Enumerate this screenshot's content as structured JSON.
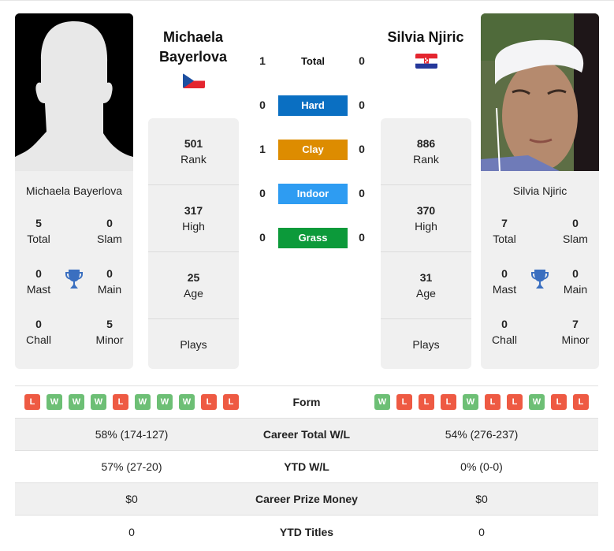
{
  "players": {
    "left": {
      "name": "Michaela Bayerlova",
      "name_line1": "Michaela",
      "name_line2": "Bayerlova",
      "country_flag": "czech-republic-flag",
      "photo": "silhouette-placeholder",
      "titles": {
        "total": {
          "value": "5",
          "label": "Total"
        },
        "slam": {
          "value": "0",
          "label": "Slam"
        },
        "mast": {
          "value": "0",
          "label": "Mast"
        },
        "main": {
          "value": "0",
          "label": "Main"
        },
        "chall": {
          "value": "0",
          "label": "Chall"
        },
        "minor": {
          "value": "5",
          "label": "Minor"
        }
      },
      "stats": {
        "rank": {
          "value": "501",
          "label": "Rank"
        },
        "high": {
          "value": "317",
          "label": "High"
        },
        "age": {
          "value": "25",
          "label": "Age"
        },
        "plays": {
          "value": "",
          "label": "Plays"
        }
      },
      "form": [
        "L",
        "W",
        "W",
        "W",
        "L",
        "W",
        "W",
        "W",
        "L",
        "L"
      ]
    },
    "right": {
      "name": "Silvia Njiric",
      "country_flag": "croatia-flag",
      "photo": "player-photo",
      "titles": {
        "total": {
          "value": "7",
          "label": "Total"
        },
        "slam": {
          "value": "0",
          "label": "Slam"
        },
        "mast": {
          "value": "0",
          "label": "Mast"
        },
        "main": {
          "value": "0",
          "label": "Main"
        },
        "chall": {
          "value": "0",
          "label": "Chall"
        },
        "minor": {
          "value": "7",
          "label": "Minor"
        }
      },
      "stats": {
        "rank": {
          "value": "886",
          "label": "Rank"
        },
        "high": {
          "value": "370",
          "label": "High"
        },
        "age": {
          "value": "31",
          "label": "Age"
        },
        "plays": {
          "value": "",
          "label": "Plays"
        }
      },
      "form": [
        "W",
        "L",
        "L",
        "L",
        "W",
        "L",
        "L",
        "W",
        "L",
        "L"
      ]
    }
  },
  "h2h": [
    {
      "label": "Total",
      "left": "1",
      "right": "0",
      "color": ""
    },
    {
      "label": "Hard",
      "left": "0",
      "right": "0",
      "color": "#0a6fc2"
    },
    {
      "label": "Clay",
      "left": "1",
      "right": "0",
      "color": "#dd8c00"
    },
    {
      "label": "Indoor",
      "left": "0",
      "right": "0",
      "color": "#2e9cf2"
    },
    {
      "label": "Grass",
      "left": "0",
      "right": "0",
      "color": "#0c9a3a"
    }
  ],
  "table": {
    "form_label": "Form",
    "rows": [
      {
        "label": "Career Total W/L",
        "left": "58% (174-127)",
        "right": "54% (276-237)"
      },
      {
        "label": "YTD W/L",
        "left": "57% (27-20)",
        "right": "0% (0-0)"
      },
      {
        "label": "Career Prize Money",
        "left": "$0",
        "right": "$0"
      },
      {
        "label": "YTD Titles",
        "left": "0",
        "right": "0"
      }
    ]
  },
  "colors": {
    "win": "#6dbf75",
    "loss": "#ee5a43",
    "trophy": "#3a6fc0"
  }
}
